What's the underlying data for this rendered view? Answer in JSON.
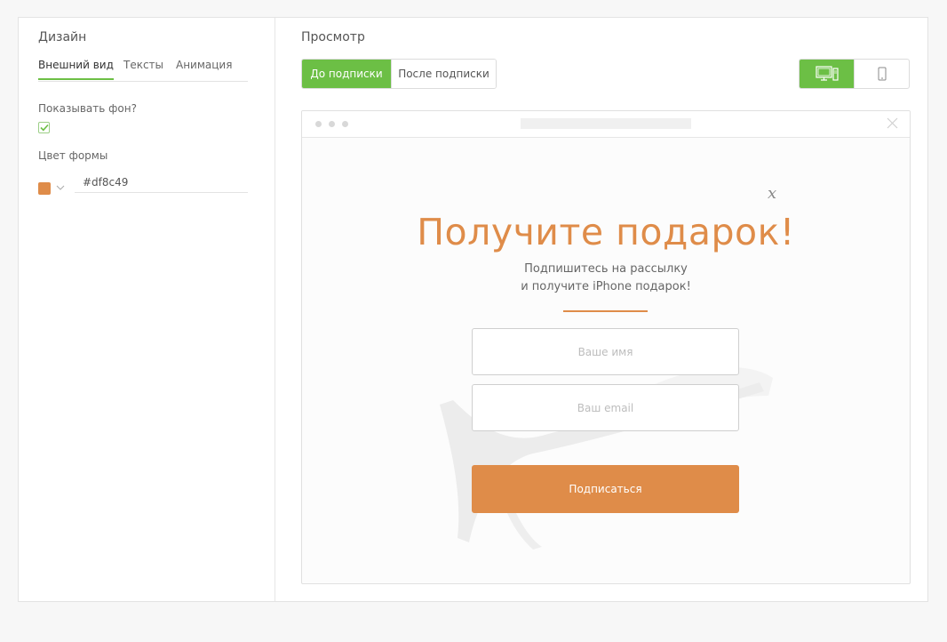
{
  "design_panel": {
    "title": "Дизайн",
    "tabs": [
      "Внешний вид",
      "Тексты",
      "Анимация"
    ],
    "show_background_label": "Показывать фон?",
    "show_background_checked": true,
    "form_color_label": "Цвет формы",
    "form_color_value": "#df8c49"
  },
  "preview_panel": {
    "title": "Просмотр",
    "state_toggle": [
      "До подписки",
      "После подписки"
    ],
    "device_toggle": [
      "desktop-icon",
      "mobile-icon"
    ]
  },
  "popup": {
    "close_glyph": "x",
    "headline": "Получите подарок!",
    "subline_1": "Подпишитесь на рассылку",
    "subline_2": "и получите iPhone подарок!",
    "name_placeholder": "Ваше имя",
    "email_placeholder": "Ваш email",
    "submit_label": "Подписаться"
  },
  "colors": {
    "accent_green": "#6cbf45",
    "form_orange": "#df8c49"
  }
}
